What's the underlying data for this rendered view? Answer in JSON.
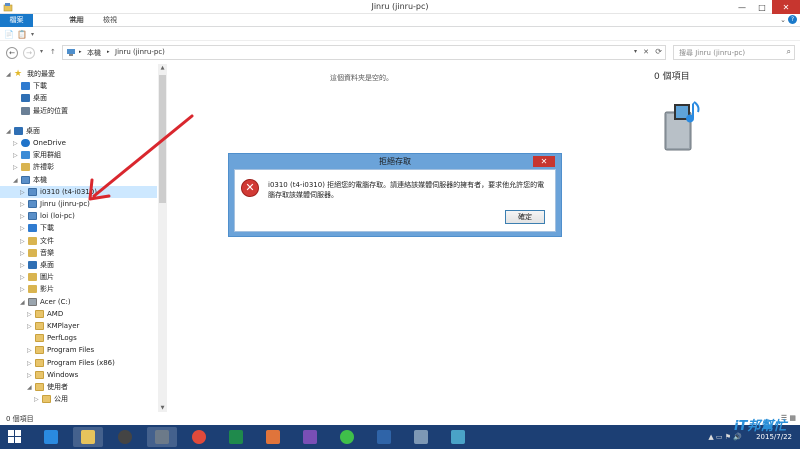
{
  "window": {
    "title": "Jinru (jinru-pc)",
    "minimize": "—",
    "maximize": "□",
    "close": "✕"
  },
  "ribbon": {
    "tabs": [
      "檔案",
      "常用",
      "共用",
      "檢視"
    ],
    "expand": "⌄",
    "help": "?"
  },
  "qat": {
    "items": [
      "📄",
      "📋",
      "▾"
    ]
  },
  "address": {
    "back": "←",
    "forward": "→",
    "recent": "▾",
    "up": "↑",
    "crumbs": [
      "▸",
      "本機",
      "▸",
      "Jinru (jinru-pc)"
    ],
    "dropdown": "▾",
    "clear": "✕",
    "refresh": "⟳"
  },
  "search": {
    "placeholder": "搜尋 Jinru (jinru-pc)",
    "icon": "⌕"
  },
  "nav": {
    "items": [
      {
        "label": "我的最愛",
        "icon": "star-icon",
        "level": 0,
        "chevron": "◢"
      },
      {
        "label": "下載",
        "icon": "download-icon",
        "level": 1,
        "chevron": ""
      },
      {
        "label": "桌面",
        "icon": "desktop-icon",
        "level": 1,
        "chevron": ""
      },
      {
        "label": "最近的位置",
        "icon": "recent-icon",
        "level": 1,
        "chevron": ""
      },
      {
        "label": "桌面",
        "icon": "desktop-icon",
        "level": 0,
        "chevron": "◢"
      },
      {
        "label": "OneDrive",
        "icon": "cloud-icon",
        "level": 1,
        "chevron": "▷"
      },
      {
        "label": "家用群組",
        "icon": "homegroup-icon",
        "level": 1,
        "chevron": "▷"
      },
      {
        "label": "許禮彰",
        "icon": "user-folder-icon",
        "level": 1,
        "chevron": "▷"
      },
      {
        "label": "本機",
        "icon": "pc-icon",
        "level": 1,
        "chevron": "◢"
      },
      {
        "label": "i0310 (t4-i0310)",
        "icon": "network-pc-icon",
        "level": 2,
        "chevron": "▷",
        "selected": true
      },
      {
        "label": "Jinru (jinru-pc)",
        "icon": "network-pc-icon",
        "level": 2,
        "chevron": "▷"
      },
      {
        "label": "loi (loi-pc)",
        "icon": "network-pc-icon",
        "level": 2,
        "chevron": "▷"
      },
      {
        "label": "下載",
        "icon": "download-icon",
        "level": 2,
        "chevron": "▷"
      },
      {
        "label": "文件",
        "icon": "documents-icon",
        "level": 2,
        "chevron": "▷"
      },
      {
        "label": "音樂",
        "icon": "music-icon",
        "level": 2,
        "chevron": "▷"
      },
      {
        "label": "桌面",
        "icon": "desktop-icon",
        "level": 2,
        "chevron": "▷"
      },
      {
        "label": "圖片",
        "icon": "pictures-icon",
        "level": 2,
        "chevron": "▷"
      },
      {
        "label": "影片",
        "icon": "videos-icon",
        "level": 2,
        "chevron": "▷"
      },
      {
        "label": "Acer (C:)",
        "icon": "drive-icon",
        "level": 2,
        "chevron": "◢"
      },
      {
        "label": "AMD",
        "icon": "folder-icon",
        "level": 3,
        "chevron": "▷"
      },
      {
        "label": "KMPlayer",
        "icon": "folder-icon",
        "level": 3,
        "chevron": "▷"
      },
      {
        "label": "PerfLogs",
        "icon": "folder-icon",
        "level": 3,
        "chevron": ""
      },
      {
        "label": "Program Files",
        "icon": "folder-icon",
        "level": 3,
        "chevron": "▷"
      },
      {
        "label": "Program Files (x86)",
        "icon": "folder-icon",
        "level": 3,
        "chevron": "▷"
      },
      {
        "label": "Windows",
        "icon": "folder-icon",
        "level": 3,
        "chevron": "▷"
      },
      {
        "label": "使用者",
        "icon": "folder-icon",
        "level": 3,
        "chevron": "◢"
      },
      {
        "label": "公用",
        "icon": "folder-icon",
        "level": 4,
        "chevron": "▷"
      }
    ]
  },
  "content": {
    "empty_message": "這個資料夾是空的。"
  },
  "details": {
    "count": "0 個項目"
  },
  "status": {
    "text": "0 個項目",
    "views": "☰ ▦"
  },
  "dialog": {
    "title": "拒絕存取",
    "close": "✕",
    "icon": "✕",
    "message": "i0310 (t4-i0310) 拒絕您的電腦存取。請連絡該媒體伺服器的擁有者，要求他允許您的電腦存取該媒體伺服器。",
    "ok_label": "確定"
  },
  "taskbar": {
    "apps": [
      {
        "name": "ie-taskbar-button",
        "color": "#2a8ae0"
      },
      {
        "name": "explorer-taskbar-button",
        "color": "#e6c35c",
        "active": true
      },
      {
        "name": "camera-taskbar-button",
        "color": "#444444"
      },
      {
        "name": "media-taskbar-button",
        "color": "#6c7a89",
        "active": true
      },
      {
        "name": "chrome-taskbar-button",
        "color": "#e04a3b"
      },
      {
        "name": "excel-taskbar-button",
        "color": "#1f8a4c"
      },
      {
        "name": "photo-taskbar-button",
        "color": "#e0743b"
      },
      {
        "name": "vs-taskbar-button",
        "color": "#7a4fb5"
      },
      {
        "name": "line-taskbar-button",
        "color": "#3fbf4a"
      },
      {
        "name": "virtualbox-taskbar-button",
        "color": "#2f64a8"
      },
      {
        "name": "network-taskbar-button",
        "color": "#7d98b5"
      },
      {
        "name": "screenshot-taskbar-button",
        "color": "#4aa3c7"
      }
    ],
    "tray": "▲ ▭ ⚑ 🔊",
    "date": "2015/7/22"
  },
  "watermark": "iT邦幫忙"
}
